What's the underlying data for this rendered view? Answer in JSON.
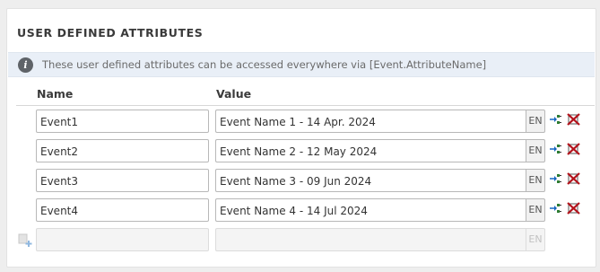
{
  "section": {
    "title": "USER DEFINED ATTRIBUTES",
    "info": "These user defined attributes can be accessed everywhere via [Event.AttributeName]"
  },
  "columns": {
    "name": "Name",
    "value": "Value"
  },
  "rows": [
    {
      "name": "Event1",
      "value": "Event Name 1 - 14 Apr. 2024",
      "lang": "EN"
    },
    {
      "name": "Event2",
      "value": "Event Name 2 - 12 May 2024",
      "lang": "EN"
    },
    {
      "name": "Event3",
      "value": "Event Name 3 - 09 Jun 2024",
      "lang": "EN"
    },
    {
      "name": "Event4",
      "value": "Event Name 4 - 14 Jul 2024",
      "lang": "EN"
    }
  ],
  "new_row": {
    "name": "",
    "value": "",
    "lang": "EN"
  },
  "icons": {
    "info": "info-icon",
    "link": "link-attribute-icon",
    "delete": "delete-attribute-icon",
    "add": "add-attribute-icon"
  },
  "colors": {
    "info_bg": "#e9eff7",
    "delete": "#b3121b",
    "link": "#2e7d32"
  }
}
